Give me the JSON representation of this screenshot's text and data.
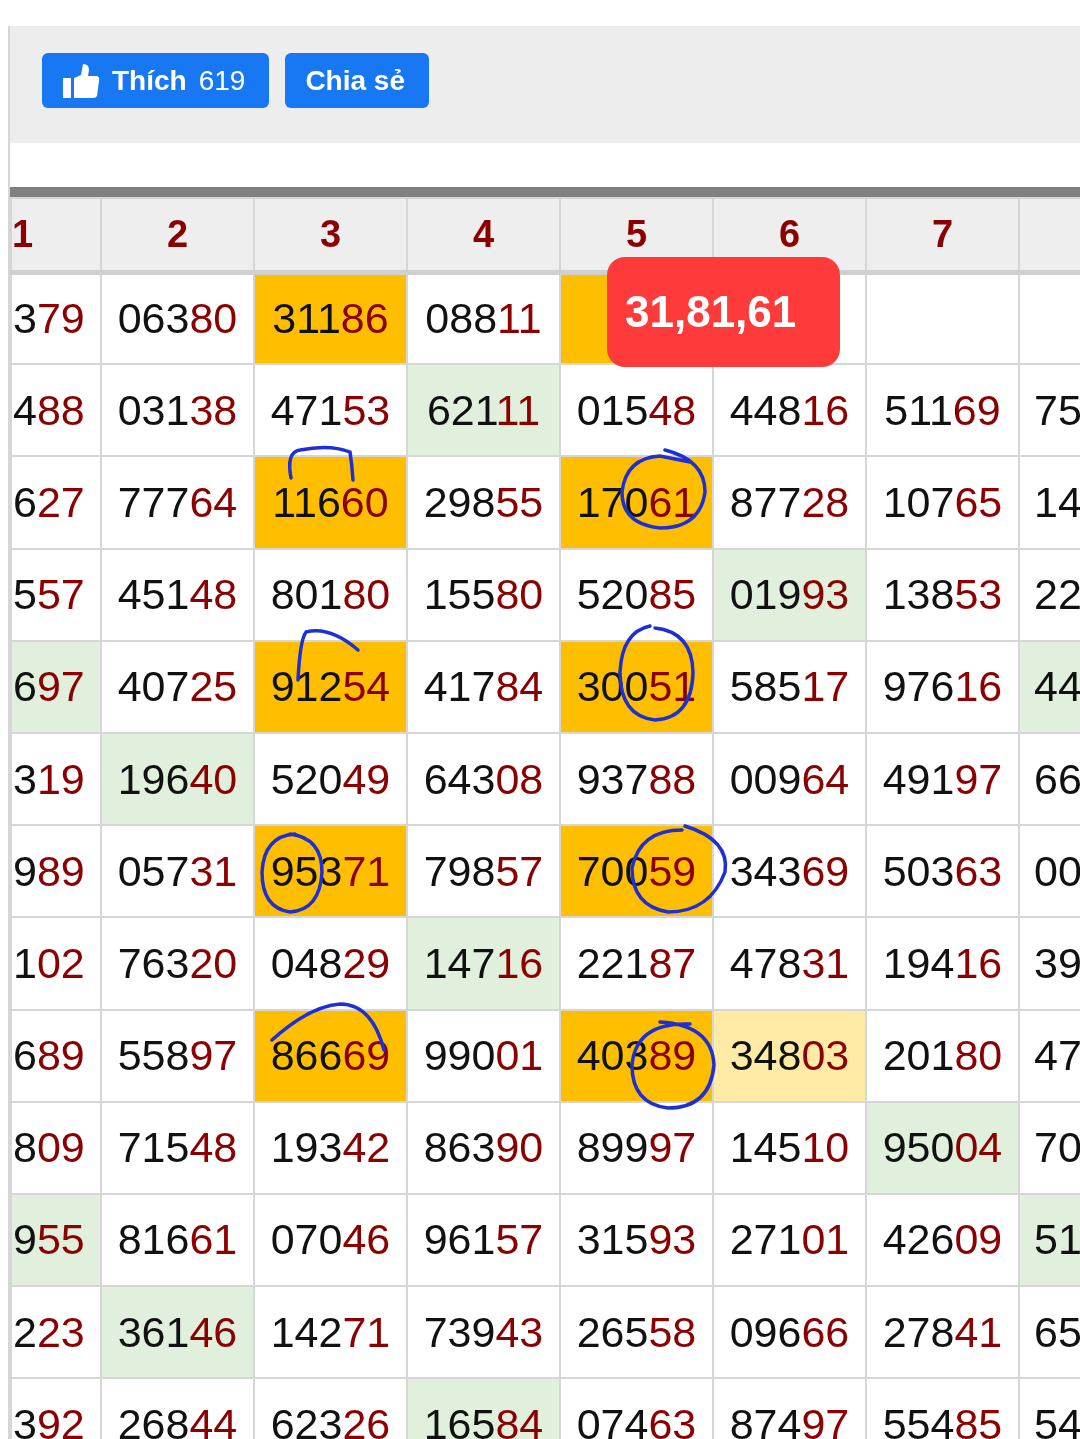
{
  "share_bar": {
    "like_button": {
      "label": "Thích",
      "count": "619"
    },
    "share_button": {
      "label": "Chia sẻ"
    }
  },
  "table": {
    "columns": [
      {
        "label": "1",
        "kind": "number"
      },
      {
        "label": "2",
        "kind": "number"
      },
      {
        "label": "3",
        "kind": "number"
      },
      {
        "label": "4",
        "kind": "number"
      },
      {
        "label": "5",
        "kind": "number"
      },
      {
        "label": "6",
        "kind": "number"
      },
      {
        "label": "7",
        "kind": "number"
      },
      {
        "kind": "cut"
      }
    ],
    "rows": [
      {
        "cells": [
          {
            "text": "379"
          },
          {
            "text": "06380"
          },
          {
            "text": "31186",
            "color": "#ffbf00"
          },
          {
            "text": "08811"
          },
          {
            "color": "#ffbf00"
          },
          {},
          {},
          {}
        ]
      },
      {
        "cells": [
          {
            "text": "488"
          },
          {
            "text": "03138"
          },
          {
            "text": "47153"
          },
          {
            "text": "62111",
            "color": "#e1f0dc"
          },
          {
            "text": "01548"
          },
          {
            "text": "44816"
          },
          {
            "text": "51169"
          },
          {
            "text": "75"
          }
        ]
      },
      {
        "cells": [
          {
            "text": "627"
          },
          {
            "text": "77764"
          },
          {
            "text": "11660",
            "color": "#ffbf00"
          },
          {
            "text": "29855"
          },
          {
            "text": "17061",
            "color": "#ffbf00"
          },
          {
            "text": "87728"
          },
          {
            "text": "10765"
          },
          {
            "text": "14"
          }
        ]
      },
      {
        "cells": [
          {
            "text": "557"
          },
          {
            "text": "45148"
          },
          {
            "text": "80180"
          },
          {
            "text": "15580"
          },
          {
            "text": "52085"
          },
          {
            "text": "01993",
            "color": "#e1f0dc"
          },
          {
            "text": "13853"
          },
          {
            "text": "22"
          }
        ]
      },
      {
        "cells": [
          {
            "text": "697",
            "color": "#e1f0dc"
          },
          {
            "text": "40725"
          },
          {
            "text": "91254",
            "color": "#ffbf00"
          },
          {
            "text": "41784"
          },
          {
            "text": "30051",
            "color": "#ffbf00"
          },
          {
            "text": "58517"
          },
          {
            "text": "97616"
          },
          {
            "text": "44",
            "color": "#e1f0dc"
          }
        ]
      },
      {
        "cells": [
          {
            "text": "319"
          },
          {
            "text": "19640",
            "color": "#e1f0dc"
          },
          {
            "text": "52049"
          },
          {
            "text": "64308"
          },
          {
            "text": "93788"
          },
          {
            "text": "00964"
          },
          {
            "text": "49197"
          },
          {
            "text": "66"
          }
        ]
      },
      {
        "cells": [
          {
            "text": "989"
          },
          {
            "text": "05731"
          },
          {
            "text": "95371",
            "color": "#ffbf00"
          },
          {
            "text": "79857"
          },
          {
            "text": "70059",
            "color": "#ffbf00"
          },
          {
            "text": "34369"
          },
          {
            "text": "50363"
          },
          {
            "text": "00"
          }
        ]
      },
      {
        "cells": [
          {
            "text": "102"
          },
          {
            "text": "76320"
          },
          {
            "text": "04829"
          },
          {
            "text": "14716",
            "color": "#e1f0dc"
          },
          {
            "text": "22187"
          },
          {
            "text": "47831"
          },
          {
            "text": "19416"
          },
          {
            "text": "39"
          }
        ]
      },
      {
        "cells": [
          {
            "text": "689"
          },
          {
            "text": "55897"
          },
          {
            "text": "86669",
            "color": "#ffbf00"
          },
          {
            "text": "99001"
          },
          {
            "text": "40389",
            "color": "#ffbf00"
          },
          {
            "text": "34803",
            "color": "#ffeaa6"
          },
          {
            "text": "20180"
          },
          {
            "text": "47"
          }
        ]
      },
      {
        "cells": [
          {
            "text": "809"
          },
          {
            "text": "71548"
          },
          {
            "text": "19342"
          },
          {
            "text": "86390"
          },
          {
            "text": "89997"
          },
          {
            "text": "14510"
          },
          {
            "text": "95004",
            "color": "#e1f0dc"
          },
          {
            "text": "70"
          }
        ]
      },
      {
        "cells": [
          {
            "text": "955",
            "color": "#e1f0dc"
          },
          {
            "text": "81661"
          },
          {
            "text": "07046"
          },
          {
            "text": "96157"
          },
          {
            "text": "31593"
          },
          {
            "text": "27101"
          },
          {
            "text": "42609"
          },
          {
            "text": "51",
            "color": "#e1f0dc"
          }
        ]
      },
      {
        "cells": [
          {
            "text": "223"
          },
          {
            "text": "36146",
            "color": "#e1f0dc"
          },
          {
            "text": "14271"
          },
          {
            "text": "73943"
          },
          {
            "text": "26558"
          },
          {
            "text": "09666"
          },
          {
            "text": "27841"
          },
          {
            "text": "65"
          }
        ]
      },
      {
        "cells": [
          {
            "text": "392"
          },
          {
            "text": "26844"
          },
          {
            "text": "62326"
          },
          {
            "text": "16584",
            "color": "#e1f0dc"
          },
          {
            "text": "07463"
          },
          {
            "text": "87497"
          },
          {
            "text": "55485"
          },
          {
            "text": "54"
          }
        ]
      }
    ]
  },
  "badge": {
    "text": "31,81,61"
  }
}
